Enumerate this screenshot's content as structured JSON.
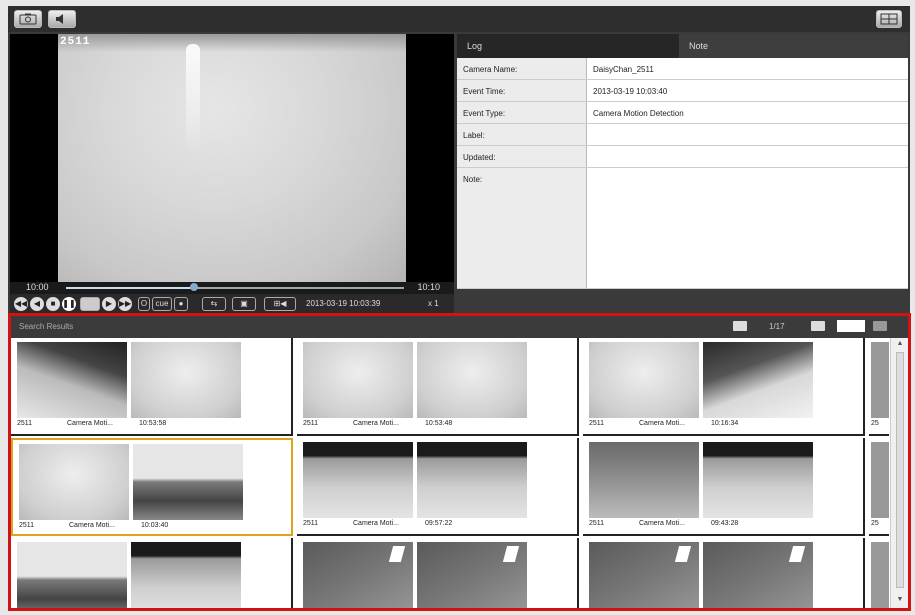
{
  "camera": {
    "overlay_label": "2511"
  },
  "timeline": {
    "start": "10:00",
    "end": "10:10",
    "position": 0.38
  },
  "player": {
    "ptz_label": "O",
    "cue_label": "cue",
    "timestamp": "2013-03-19 10:03:39",
    "speed": "x 1"
  },
  "log": {
    "tabs": [
      {
        "label": "Log"
      },
      {
        "label": "Note"
      }
    ],
    "rows": [
      {
        "key": "Camera Name:",
        "value": "DaisyChan_2511"
      },
      {
        "key": "Event Time:",
        "value": "2013-03-19 10:03:40"
      },
      {
        "key": "Event Type:",
        "value": "Camera Motion Detection"
      },
      {
        "key": "Label:",
        "value": ""
      },
      {
        "key": "Updated:",
        "value": ""
      },
      {
        "key": "Note:",
        "value": ""
      }
    ]
  },
  "results": {
    "title": "Search Results",
    "pages": "1/17",
    "items": [
      {
        "camera": "2511",
        "event": "Camera Moti...",
        "time": "10:53:58",
        "look_a": "t-shadow",
        "look_b": "t-frost"
      },
      {
        "camera": "2511",
        "event": "Camera Moti...",
        "time": "10:53:48",
        "look_a": "t-frost",
        "look_b": "t-frost"
      },
      {
        "camera": "2511",
        "event": "Camera Moti...",
        "time": "10:16:34",
        "look_a": "t-frost",
        "look_b": "t-dark"
      },
      {
        "camera": "2511",
        "event": "Camera Moti...",
        "time": "10:03:40",
        "look_a": "t-frost",
        "look_b": "t-bowl",
        "selected": true
      },
      {
        "camera": "2511",
        "event": "Camera Moti...",
        "time": "09:57:22",
        "look_a": "t-edge",
        "look_b": "t-edge"
      },
      {
        "camera": "2511",
        "event": "Camera Moti...",
        "time": "09:43:28",
        "look_a": "t-floor",
        "look_b": "t-edge"
      },
      {
        "camera": "",
        "event": "",
        "time": "",
        "look_a": "t-bowl",
        "look_b": "t-edge"
      },
      {
        "camera": "",
        "event": "",
        "time": "",
        "look_a": "t-tile",
        "look_b": "t-tile"
      },
      {
        "camera": "",
        "event": "",
        "time": "",
        "look_a": "t-tile",
        "look_b": "t-tile"
      }
    ],
    "partial_caption": "25"
  },
  "icons": [
    "camera-icon",
    "speaker-icon",
    "layout-icon",
    "rewind-icon",
    "play-icon",
    "pause-icon",
    "sync-icon",
    "export-icon",
    "thumbnail-view-icon",
    "list-view-icon"
  ]
}
